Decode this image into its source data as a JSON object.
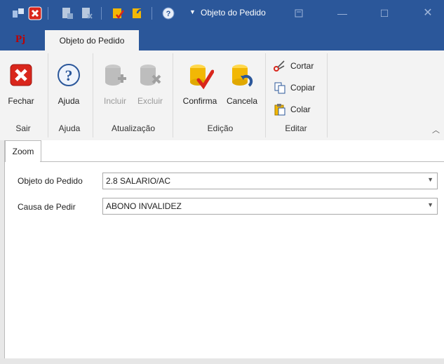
{
  "titlebar": {
    "quick_access": [
      "window-icon",
      "close-red-icon",
      "document-add-icon",
      "document-remove-icon",
      "confirm-icon",
      "cancel-icon",
      "help-icon"
    ],
    "title": "Objeto do Pedido",
    "controls": [
      "restore-icon",
      "minimize-icon",
      "maximize-icon",
      "close-icon"
    ]
  },
  "app_logo": "Pj",
  "ribbon": {
    "tab_label": "Objeto do Pedido",
    "buttons": {
      "fechar": "Fechar",
      "ajuda": "Ajuda",
      "incluir": "Incluir",
      "excluir": "Excluir",
      "confirma": "Confirma",
      "cancela": "Cancela",
      "cortar": "Cortar",
      "copiar": "Copiar",
      "colar": "Colar"
    },
    "groups": {
      "sair": "Sair",
      "ajuda": "Ajuda",
      "atualizacao": "Atualização",
      "edicao": "Edição",
      "editar": "Editar"
    }
  },
  "content": {
    "tab": "Zoom",
    "fields": {
      "objeto_label": "Objeto do Pedido",
      "objeto_value": "2.8 SALARIO/AC",
      "causa_label": "Causa de Pedir",
      "causa_value": "ABONO INVALIDEZ"
    }
  },
  "colors": {
    "titlebar": "#2b579a",
    "ribbon": "#f3f3f3",
    "accent_red": "#d9261c",
    "accent_yellow": "#f2b705"
  }
}
